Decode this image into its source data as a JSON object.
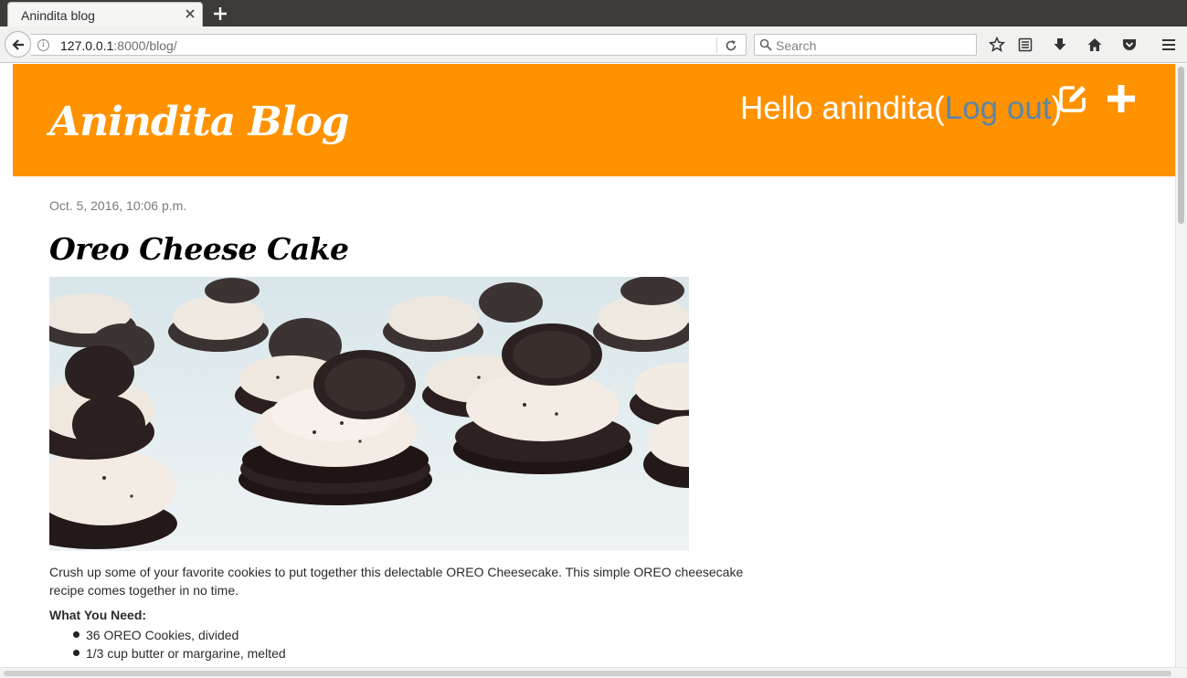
{
  "browser": {
    "tab_title": "Anindita blog",
    "url_host": "127.0.0.1",
    "url_rest": ":8000/blog/",
    "search_placeholder": "Search"
  },
  "header": {
    "site_title": "Anindita Blog",
    "greeting_prefix": "Hello anindita(",
    "logout_label": "Log out",
    "greeting_suffix": ")",
    "accent_color": "#ff9200",
    "link_color": "#5b86a6"
  },
  "post": {
    "date": "Oct. 5, 2016, 10:06 p.m.",
    "title": "Oreo Cheese Cake",
    "image_alt": "Oreo cheesecake cookies photo",
    "body": "Crush up some of your favorite cookies to put together this delectable OREO Cheesecake. This simple OREO cheesecake recipe comes together in no time.",
    "what_you_need": "What You Need:",
    "ingredients": [
      "36 OREO Cookies, divided",
      "1/3 cup butter or margarine, melted"
    ]
  }
}
